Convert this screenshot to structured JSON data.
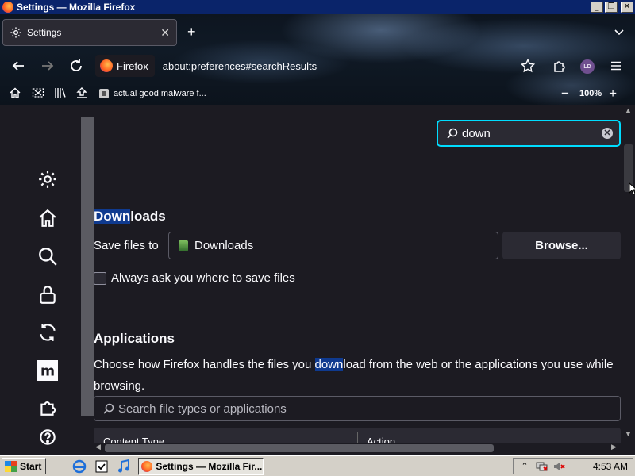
{
  "window": {
    "title": "Settings — Mozilla Firefox",
    "controls": [
      "minimize",
      "restore",
      "close"
    ]
  },
  "tabs": [
    {
      "label": "Settings",
      "icon": "gear-icon",
      "active": true
    }
  ],
  "navbar": {
    "identity_label": "Firefox",
    "url": "about:preferences#searchResults",
    "avatar_initials": "LD"
  },
  "bookmarks": {
    "items": [
      {
        "label": "actual good malware f..."
      }
    ],
    "zoom": "100%"
  },
  "settings": {
    "search_value": "down",
    "sidebar_icons": [
      "gear-icon",
      "home-icon",
      "search-icon",
      "lock-icon",
      "sync-icon",
      "more-from-mozilla-icon",
      "extensions-icon",
      "help-icon"
    ],
    "downloads": {
      "heading_match": "Down",
      "heading_rest": "loads",
      "save_files_label": "Save files to",
      "folder_value": "Downloads",
      "browse_label": "Browse...",
      "always_ask_label": "Always ask you where to save files"
    },
    "applications": {
      "heading": "Applications",
      "desc_before": "Choose how Firefox handles the files you ",
      "desc_match": "down",
      "desc_after": "load from the web or the applications you use while browsing.",
      "search_placeholder": "Search file types or applications",
      "col_content_type": "Content Type",
      "col_action": "Action"
    }
  },
  "taskbar": {
    "start_label": "Start",
    "task_label": "Settings — Mozilla Fir...",
    "clock": "4:53 AM"
  },
  "colors": {
    "accent_focus": "#00ddff",
    "highlight": "#0f3a8f",
    "page_bg": "#1c1b22"
  }
}
